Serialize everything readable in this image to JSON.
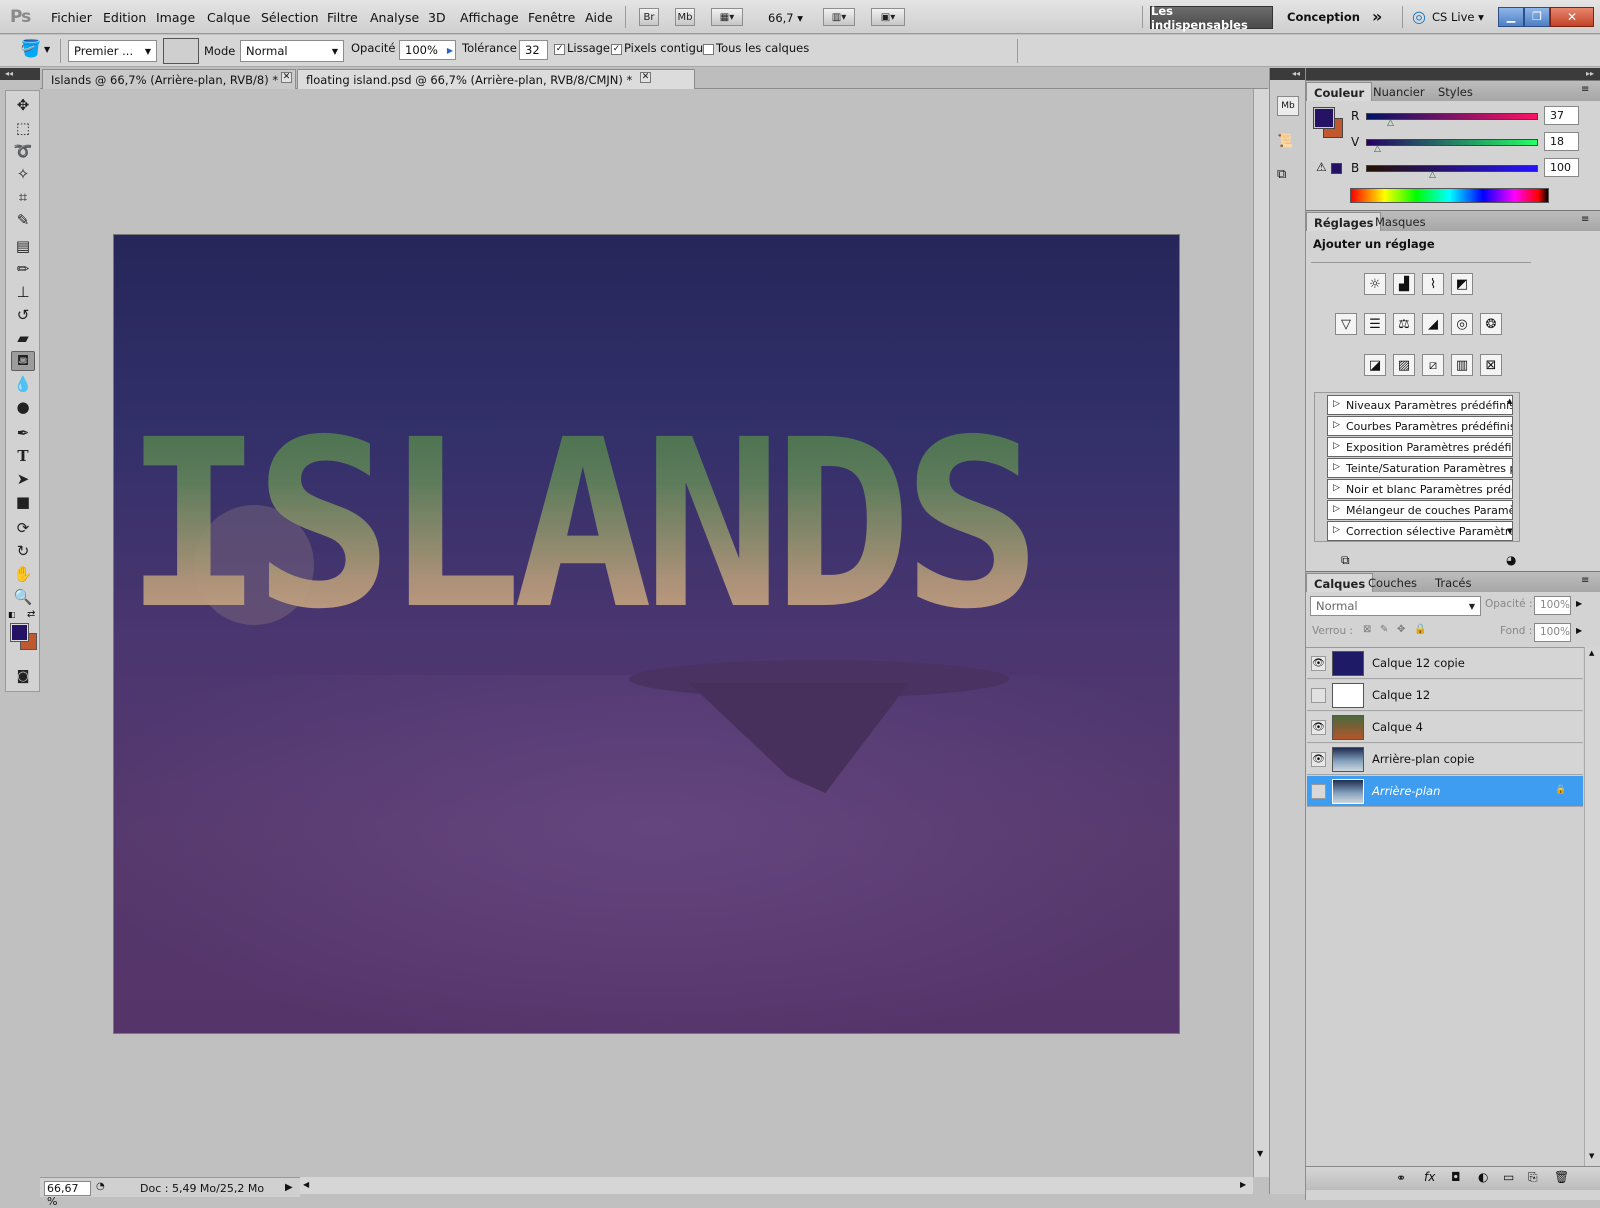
{
  "app": {
    "logo": "Ps"
  },
  "menu": [
    "Fichier",
    "Edition",
    "Image",
    "Calque",
    "Sélection",
    "Filtre",
    "Analyse",
    "3D",
    "Affichage",
    "Fenêtre",
    "Aide"
  ],
  "appbar": {
    "bridge": "Br",
    "minibridge": "Mb",
    "zoom": "66,7",
    "workspace_active": "Les indispensables",
    "workspace_other": "Conception",
    "cslive": "CS Live"
  },
  "options": {
    "preset_fill": "Premier ...",
    "mode_label": "Mode :",
    "mode_value": "Normal",
    "opacity_label": "Opacité :",
    "opacity_value": "100%",
    "tolerance_label": "Tolérance :",
    "tolerance_value": "32",
    "antialias_label": "Lissage",
    "antialias_checked": true,
    "contiguous_label": "Pixels contigus",
    "contiguous_checked": true,
    "all_layers_label": "Tous les calques",
    "all_layers_checked": false
  },
  "tabs": [
    {
      "label": "Islands @ 66,7% (Arrière-plan, RVB/8) *",
      "active": false
    },
    {
      "label": "floating island.psd @ 66,7% (Arrière-plan, RVB/8/CMJN) *",
      "active": true
    }
  ],
  "artwork": {
    "title_text": "ISLANDS"
  },
  "status": {
    "zoom": "66,67 %",
    "doc": "Doc : 5,49 Mo/25,2 Mo"
  },
  "colors": {
    "foreground": "#251264",
    "background": "#c05a2e",
    "accent_select": "#3e9df1"
  },
  "color_panel": {
    "tabs": [
      "Couleur",
      "Nuancier",
      "Styles"
    ],
    "channels": [
      {
        "label": "R",
        "value": "37",
        "fraction": 0.145
      },
      {
        "label": "V",
        "value": "18",
        "fraction": 0.071
      },
      {
        "label": "B",
        "value": "100",
        "fraction": 0.392
      }
    ]
  },
  "adjust_panel": {
    "tabs": [
      "Réglages",
      "Masques"
    ],
    "heading": "Ajouter un réglage",
    "icon_rows": [
      [
        "brightness-contrast-icon",
        "levels-icon",
        "curves-icon",
        "exposure-icon"
      ],
      [
        "vibrance-icon",
        "hue-saturation-icon",
        "color-balance-icon",
        "black-white-icon",
        "photo-filter-icon",
        "channel-mixer-icon"
      ],
      [
        "invert-icon",
        "posterize-icon",
        "threshold-icon",
        "gradient-map-icon",
        "selective-color-icon"
      ]
    ],
    "presets": [
      "Niveaux Paramètres prédéfinis",
      "Courbes Paramètres prédéfinis",
      "Exposition Paramètres prédéfinis",
      "Teinte/Saturation Paramètres p...",
      "Noir et blanc Paramètres prédéf...",
      "Mélangeur de couches Paramèt...",
      "Correction sélective Paramètres..."
    ]
  },
  "layers_panel": {
    "tabs": [
      "Calques",
      "Couches",
      "Tracés"
    ],
    "blend_mode": "Normal",
    "opacity_label": "Opacité :",
    "opacity_value": "100%",
    "lock_label": "Verrou :",
    "fill_label": "Fond :",
    "fill_value": "100%",
    "layers": [
      {
        "name": "Calque 12 copie",
        "visible": true,
        "thumb": "islands-text",
        "selected": false,
        "locked": false
      },
      {
        "name": "Calque 12",
        "visible": false,
        "thumb": "white",
        "selected": false,
        "locked": false
      },
      {
        "name": "Calque 4",
        "visible": true,
        "thumb": "gradient",
        "selected": false,
        "locked": false
      },
      {
        "name": "Arrière-plan copie",
        "visible": true,
        "thumb": "scene",
        "selected": false,
        "locked": false
      },
      {
        "name": "Arrière-plan",
        "visible": false,
        "thumb": "scene",
        "selected": true,
        "locked": true
      }
    ]
  }
}
